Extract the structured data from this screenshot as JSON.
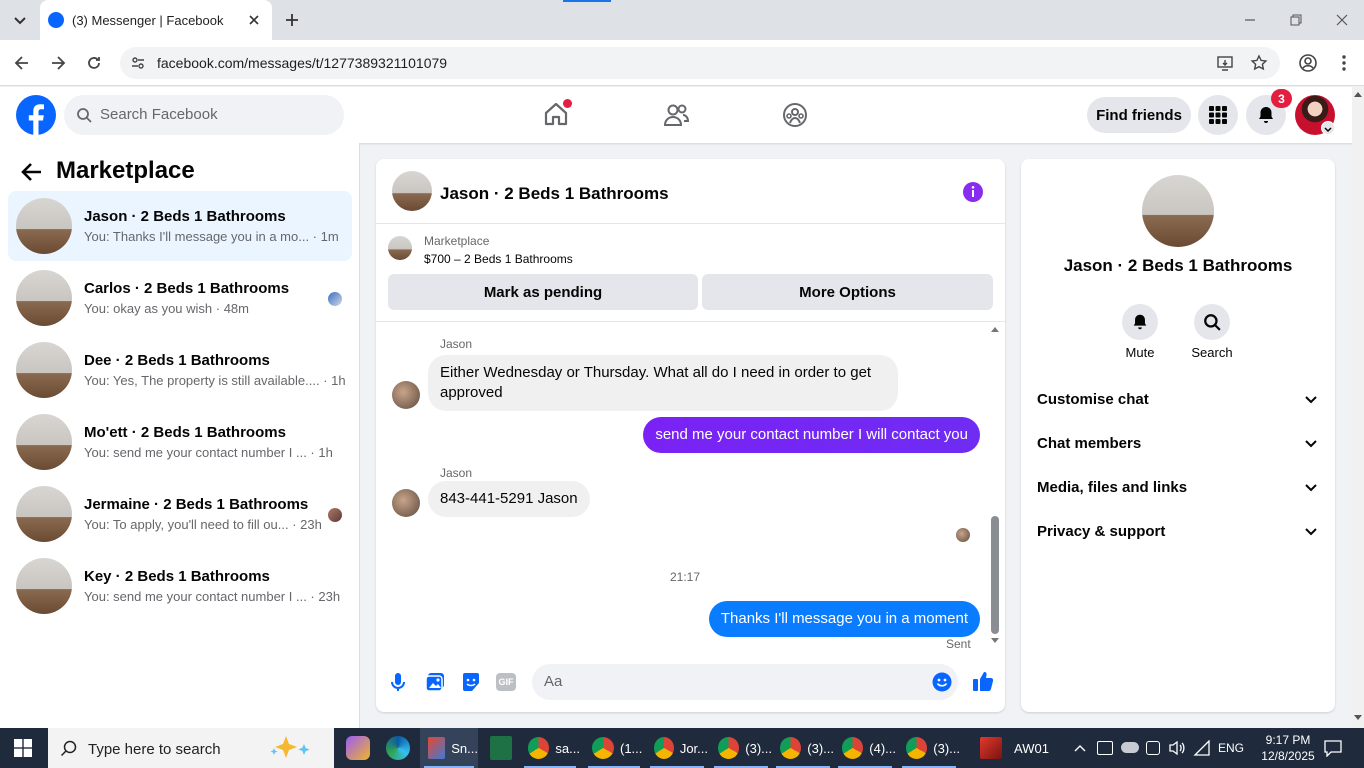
{
  "browser": {
    "tab_title": "(3) Messenger | Facebook",
    "url": "facebook.com/messages/t/1277389321101079"
  },
  "fb_header": {
    "search_placeholder": "Search Facebook",
    "find_friends": "Find friends",
    "notification_count": "3",
    "brand_color": "#0866ff"
  },
  "sidebar": {
    "title": "Marketplace",
    "conversations": [
      {
        "name": "Jason · 2 Beds 1 Bathrooms",
        "preview": "You: Thanks I'll message you in a mo... · 1m"
      },
      {
        "name": "Carlos · 2 Beds 1 Bathrooms",
        "preview": "You: okay as you wish · 48m"
      },
      {
        "name": "Dee · 2 Beds 1 Bathrooms",
        "preview": "You: Yes, The property is still available.... · 1h"
      },
      {
        "name": "Mo'ett · 2 Beds 1 Bathrooms",
        "preview": "You: send me your contact number I ... · 1h"
      },
      {
        "name": "Jermaine · 2 Beds 1 Bathrooms",
        "preview": "You: To apply, you'll need to fill ou... · 23h"
      },
      {
        "name": "Key · 2 Beds 1 Bathrooms",
        "preview": "You: send me your contact number I ... · 23h"
      }
    ]
  },
  "chat": {
    "title": "Jason · 2 Beds 1 Bathrooms",
    "listing_source": "Marketplace",
    "listing_detail": "$700 – 2 Beds 1 Bathrooms",
    "mark_pending": "Mark as pending",
    "more_options": "More Options",
    "messages": [
      {
        "sender": "Jason",
        "text": "Either Wednesday or Thursday. What all do I need in order to get approved"
      },
      {
        "sender": "You",
        "text": "send me your contact number I will contact you"
      },
      {
        "sender": "Jason",
        "text": "843-441-5291 Jason"
      },
      {
        "sender": "You",
        "text": "Thanks I'll message you in a moment"
      }
    ],
    "timestamp": "21:17",
    "status": "Sent",
    "composer_placeholder": "Aa",
    "outgoing_color": "#7a22f5",
    "accent_color": "#0a7cff"
  },
  "details": {
    "name": "Jason · 2 Beds 1 Bathrooms",
    "mute": "Mute",
    "search": "Search",
    "sections": [
      "Customise chat",
      "Chat members",
      "Media, files and links",
      "Privacy & support"
    ]
  },
  "taskbar": {
    "search_placeholder": "Type here to search",
    "apps": [
      "Sn...",
      "sa...",
      "(1...",
      "Jor...",
      "(3)...",
      "(3)...",
      "(4)...",
      "(3)...",
      "AW01"
    ],
    "language": "ENG",
    "time": "9:17 PM",
    "date": "12/8/2025"
  }
}
